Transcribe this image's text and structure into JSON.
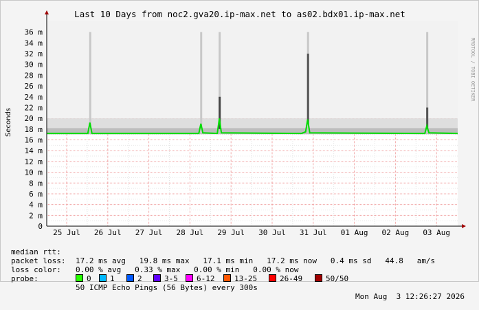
{
  "chart_data": {
    "type": "line",
    "title": "Last 10 Days from noc2.gva20.ip-max.net to as02.bdx01.ip-max.net",
    "ylabel": "Seconds",
    "side_label": "RRDTOOL / TOBI OETIKER",
    "ylim": [
      0,
      38
    ],
    "y_ticks": [
      0,
      2,
      4,
      6,
      8,
      10,
      12,
      14,
      16,
      18,
      20,
      22,
      24,
      26,
      28,
      30,
      32,
      34,
      36
    ],
    "y_tick_labels": [
      "0",
      "2 m",
      "4 m",
      "6 m",
      "8 m",
      "10 m",
      "12 m",
      "14 m",
      "16 m",
      "18 m",
      "20 m",
      "22 m",
      "24 m",
      "26 m",
      "28 m",
      "30 m",
      "32 m",
      "34 m",
      "36 m"
    ],
    "x_range": [
      "2026-07-24 12:26",
      "2026-08-03 12:26"
    ],
    "x_tick_labels": [
      "25 Jul",
      "26 Jul",
      "27 Jul",
      "28 Jul",
      "29 Jul",
      "30 Jul",
      "31 Jul",
      "01 Aug",
      "02 Aug",
      "03 Aug"
    ],
    "series": [
      {
        "name": "median rtt",
        "x_days": [
          0,
          1.0,
          1.05,
          1.1,
          2.0,
          3.7,
          3.75,
          3.8,
          4.15,
          4.2,
          4.25,
          6.2,
          6.3,
          6.35,
          6.4,
          9.2,
          9.25,
          9.3,
          10
        ],
        "values_ms": [
          17.2,
          17.2,
          19.2,
          17.2,
          17.2,
          17.2,
          19.0,
          17.3,
          17.2,
          20.0,
          17.3,
          17.2,
          17.5,
          19.8,
          17.3,
          17.2,
          18.6,
          17.3,
          17.2
        ]
      }
    ],
    "grid": true,
    "color_median": "#00dd00",
    "color_smoke": "#888888"
  },
  "legend": {
    "median_label": "median rtt:",
    "median_values": "17.2 ms avg   19.8 ms max   17.1 ms min   17.2 ms now   0.4 ms sd   44.8   am/s",
    "loss_label": "packet loss:",
    "loss_values": "0.00 % avg   0.33 % max   0.00 % min   0.00 % now",
    "color_label": "loss color:",
    "colors": [
      {
        "label": "0",
        "color": "#26ff00"
      },
      {
        "label": "1",
        "color": "#00b8ff"
      },
      {
        "label": "2",
        "color": "#0059ff"
      },
      {
        "label": "3-5",
        "color": "#5e00ff"
      },
      {
        "label": "6-12",
        "color": "#ff00ff"
      },
      {
        "label": "13-25",
        "color": "#ff5500"
      },
      {
        "label": "26-49",
        "color": "#ff0000"
      },
      {
        "label": "50/50",
        "color": "#a10000"
      }
    ],
    "probe_label": "probe:",
    "probe_value": "50 ICMP Echo Pings (56 Bytes) every 300s",
    "date": "Mon Aug  3 12:26:27 2026"
  }
}
